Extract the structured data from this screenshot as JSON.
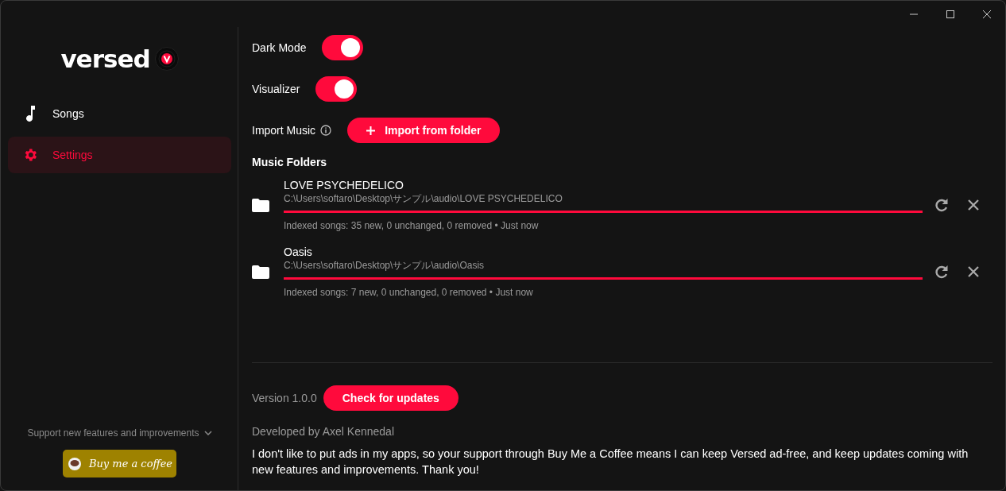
{
  "sidebar": {
    "logo": "versed",
    "items": [
      {
        "label": "Songs",
        "selected": false
      },
      {
        "label": "Settings",
        "selected": true
      }
    ],
    "support_text": "Support new features and improvements",
    "coffee_button": "Buy me a coffee"
  },
  "settings": {
    "toggles": [
      {
        "label": "Dark Mode",
        "on": true
      },
      {
        "label": "Visualizer",
        "on": true
      }
    ],
    "import_label": "Import Music",
    "import_button": "Import from folder",
    "folders_heading": "Music Folders",
    "folders": [
      {
        "name": "LOVE PSYCHEDELICO",
        "path": "C:\\Users\\softaro\\Desktop\\サンプル\\audio\\LOVE PSYCHEDELICO",
        "level": 1,
        "status": "Indexed songs: 35 new, 0 unchanged, 0 removed • Just now"
      },
      {
        "name": "Oasis",
        "path": "C:\\Users\\softaro\\Desktop\\サンプル\\audio\\Oasis",
        "level": 1,
        "status": "Indexed songs: 7 new, 0 unchanged, 0 removed • Just now"
      }
    ],
    "version": "Version 1.0.0",
    "update_button": "Check for updates",
    "developer": "Developed by Axel Kennedal",
    "message": "I don't like to put ads in my apps, so your support through Buy Me a Coffee means I can keep Versed ad-free, and keep updates coming with new features and improvements. Thank you!"
  }
}
